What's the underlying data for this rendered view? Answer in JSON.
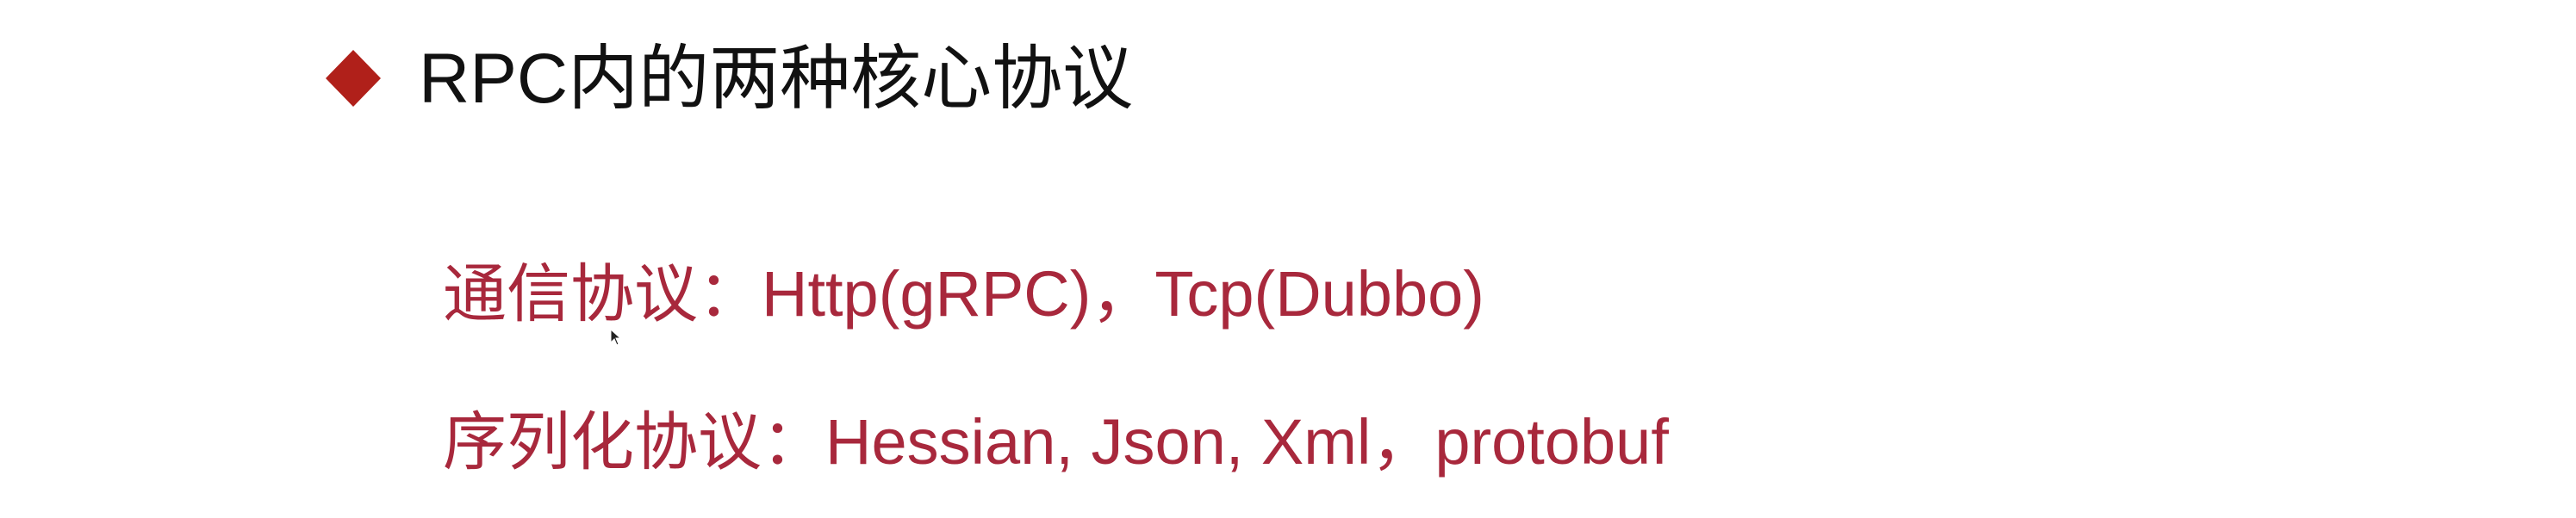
{
  "header": {
    "bullet_icon": "red-diamond-icon",
    "title": "RPC内的两种核心协议"
  },
  "items": [
    {
      "label": "通信协议：",
      "value": "Http(gRPC)，Tcp(Dubbo)"
    },
    {
      "label": "序列化协议：",
      "value": "Hessian, Json, Xml，protobuf"
    }
  ],
  "colors": {
    "bullet": "#b0201a",
    "title": "#111111",
    "item_text": "#a8283c"
  }
}
